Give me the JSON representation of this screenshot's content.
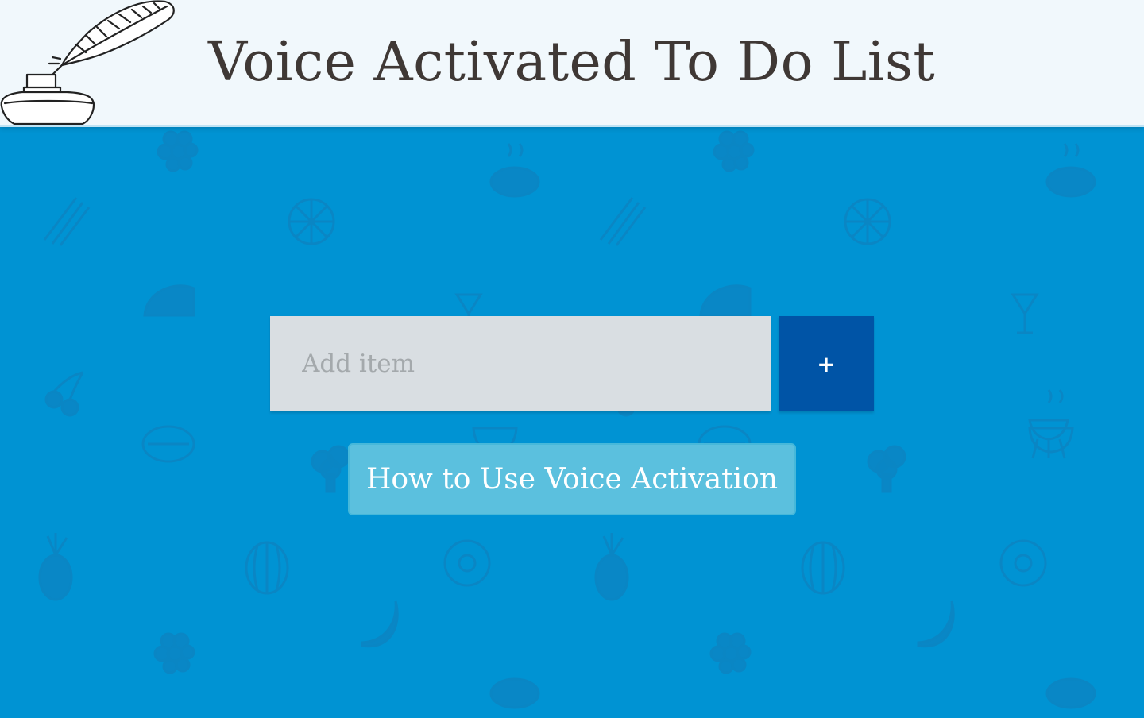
{
  "header": {
    "title": "Voice Activated To Do List",
    "logo_icon": "quill-and-inkwell-icon"
  },
  "todo": {
    "input_placeholder": "Add item",
    "input_value": "",
    "add_button_label": "+",
    "howto_button_label": "How to Use Voice Activation"
  },
  "theme": {
    "background": "#0093d3",
    "header_bg": "#f1f8fc",
    "add_button_bg": "#0054a6",
    "howto_button_bg": "#5bc0de"
  },
  "background_pattern_icons": [
    "grapes-icon",
    "steak-icon",
    "asparagus-icon",
    "citrus-slice-icon",
    "roast-chicken-icon",
    "cocktail-icon",
    "cherries-icon",
    "lemon-icon",
    "broccoli-icon",
    "bowl-icon",
    "grill-icon",
    "pineapple-icon",
    "watermelon-icon",
    "donut-icon",
    "banana-icon"
  ]
}
